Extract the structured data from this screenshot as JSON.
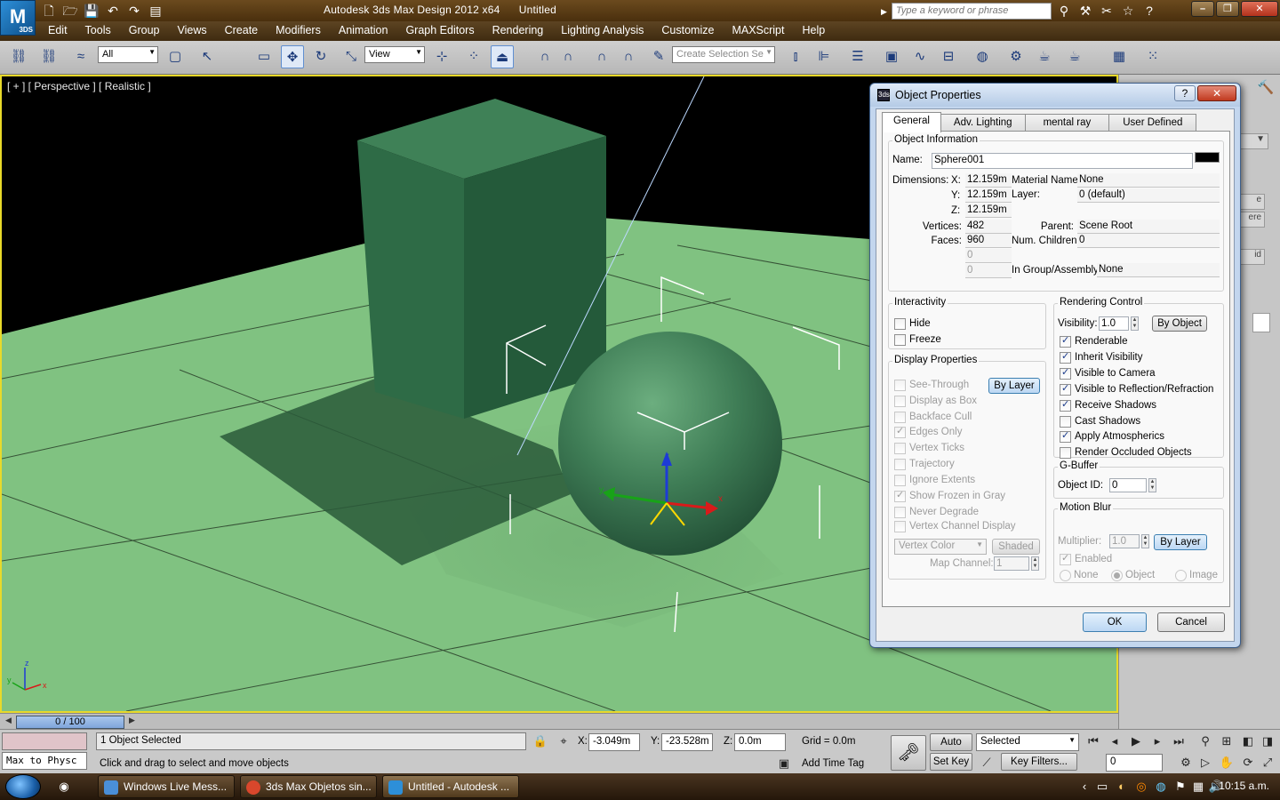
{
  "app": {
    "logo": "M",
    "logo_sub": "3DS",
    "title": "Autodesk 3ds Max Design 2012 x64      Untitled",
    "search_placeholder": "Type a keyword or phrase"
  },
  "quick_access": [
    "new-icon",
    "open-icon",
    "save-icon",
    "undo-icon",
    "redo-icon",
    "project-icon"
  ],
  "menu": [
    "Edit",
    "Tools",
    "Group",
    "Views",
    "Create",
    "Modifiers",
    "Animation",
    "Graph Editors",
    "Rendering",
    "Lighting Analysis",
    "Customize",
    "MAXScript",
    "Help"
  ],
  "toolbar": {
    "selection_filter": "All",
    "ref_coord": "View",
    "named_selection": "Create Selection Se"
  },
  "viewport": {
    "label": "[ + ] [ Perspective ] [ Realistic ]",
    "axis_x": "x",
    "axis_y": "y",
    "axis_z": "z",
    "gizmo_x": "x",
    "gizmo_y": "y",
    "gizmo_z": "z"
  },
  "timeline": {
    "slider": "0 / 100"
  },
  "status": {
    "selected": "1 Object Selected",
    "prompt": "Click and drag to select and move objects",
    "script_listener": "Max to Physc",
    "x_label": "X:",
    "x": "-3.049m",
    "y_label": "Y:",
    "y": "-23.528m",
    "z_label": "Z:",
    "z": "0.0m",
    "grid": "Grid = 0.0m",
    "add_time_tag": "Add Time Tag",
    "auto_key": "Auto Key",
    "set_key": "Set Key",
    "key_mode": "Selected",
    "key_filters": "Key Filters...",
    "frame": "0"
  },
  "taskbar": {
    "items": [
      "Windows Live Mess...",
      "3ds Max Objetos sin...",
      "Untitled - Autodesk ..."
    ],
    "clock": "10:15 a.m."
  },
  "dialog": {
    "title": "Object Properties",
    "help": "?",
    "close": "✕",
    "tabs": [
      "General",
      "Adv. Lighting",
      "mental ray",
      "User Defined"
    ],
    "object_info": {
      "title": "Object Information",
      "name_label": "Name:",
      "name": "Sphere001",
      "dimensions_label": "Dimensions:",
      "x_label": "X:",
      "x": "12.159m",
      "y_label": "Y:",
      "y": "12.159m",
      "z_label": "Z:",
      "z": "12.159m",
      "vertices_label": "Vertices:",
      "vertices": "482",
      "faces_label": "Faces:",
      "faces": "960",
      "blank1": "0",
      "blank2": "0",
      "material_label": "Material Name:",
      "material": "None",
      "layer_label": "Layer:",
      "layer": "0 (default)",
      "parent_label": "Parent:",
      "parent": "Scene Root",
      "children_label": "Num. Children:",
      "children": "0",
      "group_label": "In Group/Assembly:",
      "group": "None"
    },
    "interactivity": {
      "title": "Interactivity",
      "hide": "Hide",
      "freeze": "Freeze"
    },
    "display": {
      "title": "Display Properties",
      "by_layer": "By Layer",
      "items": [
        "See-Through",
        "Display as Box",
        "Backface Cull",
        "Edges Only",
        "Vertex Ticks",
        "Trajectory",
        "Ignore Extents",
        "Show Frozen in Gray",
        "Never Degrade",
        "Vertex Channel Display"
      ],
      "vertex_color": "Vertex Color",
      "shaded": "Shaded",
      "map_channel_label": "Map Channel:",
      "map_channel": "1"
    },
    "rendering": {
      "title": "Rendering Control",
      "visibility_label": "Visibility:",
      "visibility": "1.0",
      "by_object": "By Object",
      "items": [
        "Renderable",
        "Inherit Visibility",
        "Visible to Camera",
        "Visible to Reflection/Refraction",
        "Receive Shadows",
        "Cast Shadows",
        "Apply Atmospherics",
        "Render Occluded Objects"
      ]
    },
    "gbuffer": {
      "title": "G-Buffer",
      "object_id_label": "Object ID:",
      "object_id": "0"
    },
    "motion_blur": {
      "title": "Motion Blur",
      "multiplier_label": "Multiplier:",
      "multiplier": "1.0",
      "by_layer": "By Layer",
      "enabled": "Enabled",
      "none": "None",
      "object": "Object",
      "image": "Image"
    },
    "ok": "OK",
    "cancel": "Cancel"
  },
  "command_panel": [
    "e",
    "ere",
    "id"
  ],
  "colors": {
    "ground": "#7fbf7f",
    "box": "#2f6b47",
    "sphere": "#3d7d52",
    "viewport_border": "#e8d92a"
  }
}
